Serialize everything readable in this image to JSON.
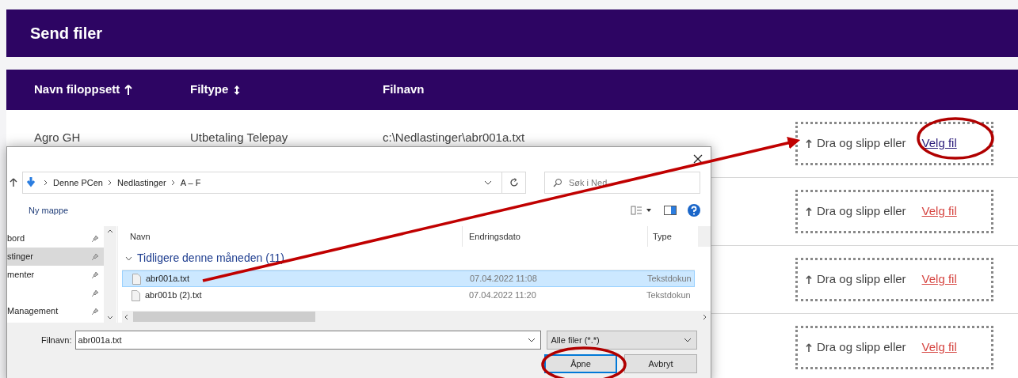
{
  "page": {
    "title": "Send filer"
  },
  "table": {
    "columns": [
      {
        "label": "Navn filoppsett",
        "kind": "ascending"
      },
      {
        "label": "Filtype",
        "kind": "sortable"
      },
      {
        "label": "Filnavn",
        "kind": "plain"
      }
    ],
    "rows": [
      {
        "cells": [
          "Agro GH",
          "Utbetaling Telepay",
          "c:\\Nedlastinger\\abr001a.txt"
        ],
        "upload": {
          "text": "Dra og slipp eller",
          "link": "Velg fil",
          "visited": true
        }
      },
      {
        "upload": {
          "text": "Dra og slipp eller",
          "link": "Velg fil",
          "visited": false
        }
      },
      {
        "upload": {
          "text": "Dra og slipp eller",
          "link": "Velg fil",
          "visited": false
        }
      },
      {
        "upload": {
          "text": "Dra og slipp eller",
          "link": "Velg fil",
          "visited": false
        }
      }
    ]
  },
  "dialog": {
    "breadcrumb": [
      "Denne PCen",
      "Nedlastinger",
      "A – F"
    ],
    "search_placeholder": "Søk i Ned",
    "new_folder": "Ny mappe",
    "nav_items": [
      {
        "label": "bord",
        "selected": false
      },
      {
        "label": "stinger",
        "selected": true
      },
      {
        "label": "menter",
        "selected": false
      },
      {
        "selected": false
      },
      {
        "label": "Management",
        "selected": false
      }
    ],
    "columns": [
      "Navn",
      "Endringsdato",
      "Type"
    ],
    "group": {
      "label": "Tidligere denne måneden (11)",
      "expanded": true
    },
    "files": [
      {
        "name": "abr001a.txt",
        "date": "07.04.2022 11:08",
        "type": "Tekstdokun",
        "selected": true
      },
      {
        "name": "abr001b (2).txt",
        "date": "07.04.2022 11:20",
        "type": "Tekstdokun",
        "selected": false
      }
    ],
    "filename_label": "Filnavn:",
    "filename_value": "abr001a.txt",
    "filter": "Alle filer (*.*)",
    "buttons": [
      {
        "label": "Åpne",
        "default": true
      },
      {
        "label": "Avbryt",
        "default": false
      }
    ]
  }
}
